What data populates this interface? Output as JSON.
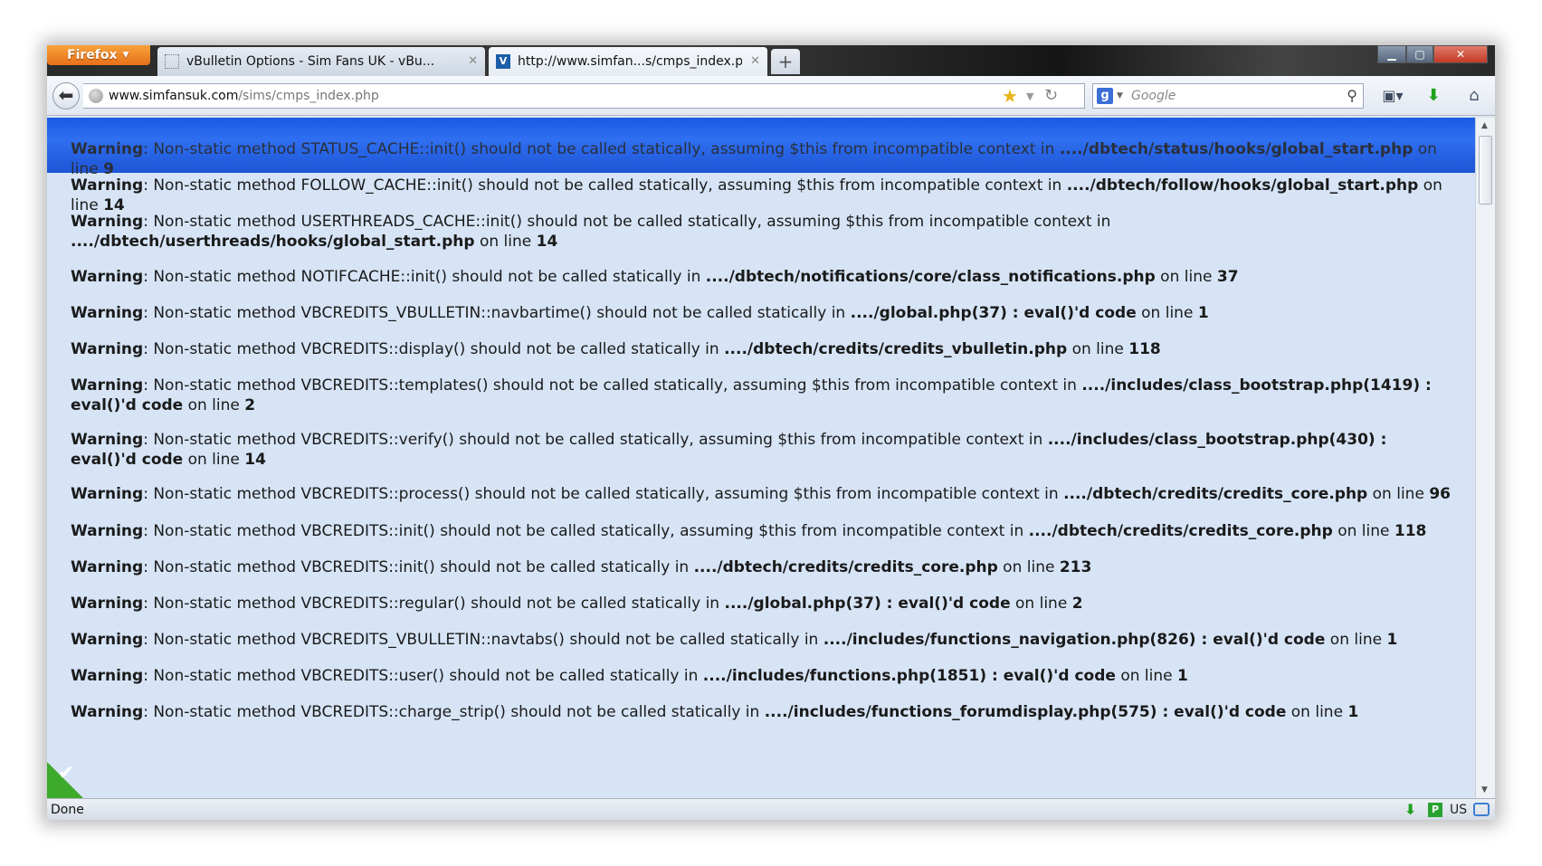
{
  "browser": {
    "menu_button": "Firefox",
    "tabs": [
      {
        "title": "vBulletin Options - Sim Fans UK - vBu..."
      },
      {
        "title": "http://www.simfan...s/cmps_index.php",
        "favicon": "V"
      }
    ],
    "new_tab": "+",
    "url_host": "www.simfansuk.com",
    "url_path": "/sims/cmps_index.php",
    "search_placeholder": "Google",
    "search_engine": "g"
  },
  "warnings": [
    {
      "label": "Warning",
      "text": ": Non-static method STATUS_CACHE::init() should not be called statically, assuming $this from incompatible context in ",
      "path": "..../dbtech/status/hooks/global_start.php",
      "on": " on line ",
      "line": "9"
    },
    {
      "label": "Warning",
      "text": ": Non-static method FOLLOW_CACHE::init() should not be called statically, assuming $this from incompatible context in ",
      "path": "..../dbtech/follow/hooks/global_start.php",
      "on": " on line ",
      "line": "14"
    },
    {
      "label": "Warning",
      "text": ": Non-static method USERTHREADS_CACHE::init() should not be called statically, assuming $this from incompatible context in ",
      "path": "..../dbtech/userthreads/hooks/global_start.php",
      "on": " on line ",
      "line": "14"
    },
    {
      "label": "Warning",
      "text": ": Non-static method NOTIFCACHE::init() should not be called statically in ",
      "path": "..../dbtech/notifications/core/class_notifications.php",
      "on": " on line ",
      "line": "37"
    },
    {
      "label": "Warning",
      "text": ": Non-static method VBCREDITS_VBULLETIN::navbartime() should not be called statically in ",
      "path": "..../global.php(37) : eval()'d code",
      "on": " on line ",
      "line": "1"
    },
    {
      "label": "Warning",
      "text": ": Non-static method VBCREDITS::display() should not be called statically in ",
      "path": "..../dbtech/credits/credits_vbulletin.php",
      "on": " on line ",
      "line": "118"
    },
    {
      "label": "Warning",
      "text": ": Non-static method VBCREDITS::templates() should not be called statically, assuming $this from incompatible context in ",
      "path": "..../includes/class_bootstrap.php(1419) : eval()'d code",
      "on": " on line ",
      "line": "2"
    },
    {
      "label": "Warning",
      "text": ": Non-static method VBCREDITS::verify() should not be called statically, assuming $this from incompatible context in ",
      "path": "..../includes/class_bootstrap.php(430) : eval()'d code",
      "on": " on line ",
      "line": "14"
    },
    {
      "label": "Warning",
      "text": ": Non-static method VBCREDITS::process() should not be called statically, assuming $this from incompatible context in ",
      "path": "..../dbtech/credits/credits_core.php",
      "on": " on line ",
      "line": "96"
    },
    {
      "label": "Warning",
      "text": ": Non-static method VBCREDITS::init() should not be called statically, assuming $this from incompatible context in ",
      "path": "..../dbtech/credits/credits_core.php",
      "on": " on line ",
      "line": "118"
    },
    {
      "label": "Warning",
      "text": ": Non-static method VBCREDITS::init() should not be called statically in ",
      "path": "..../dbtech/credits/credits_core.php",
      "on": " on line ",
      "line": "213"
    },
    {
      "label": "Warning",
      "text": ": Non-static method VBCREDITS::regular() should not be called statically in ",
      "path": "..../global.php(37) : eval()'d code",
      "on": " on line ",
      "line": "2"
    },
    {
      "label": "Warning",
      "text": ": Non-static method VBCREDITS_VBULLETIN::navtabs() should not be called statically in ",
      "path": "..../includes/functions_navigation.php(826) : eval()'d code",
      "on": " on line ",
      "line": "1"
    },
    {
      "label": "Warning",
      "text": ": Non-static method VBCREDITS::user() should not be called statically in ",
      "path": "..../includes/functions.php(1851) : eval()'d code",
      "on": " on line ",
      "line": "1"
    },
    {
      "label": "Warning",
      "text": ": Non-static method VBCREDITS::charge_strip() should not be called statically in ",
      "path": "..../includes/functions_forumdisplay.php(575) : eval()'d code",
      "on": " on line ",
      "line": "1"
    }
  ],
  "status": {
    "text": "Done",
    "locale": "US",
    "badge": "P"
  },
  "colors": {
    "highlight": "#1d5ae0",
    "content_bg": "#d6e4f6",
    "firefox_orange": "#e8701a"
  }
}
